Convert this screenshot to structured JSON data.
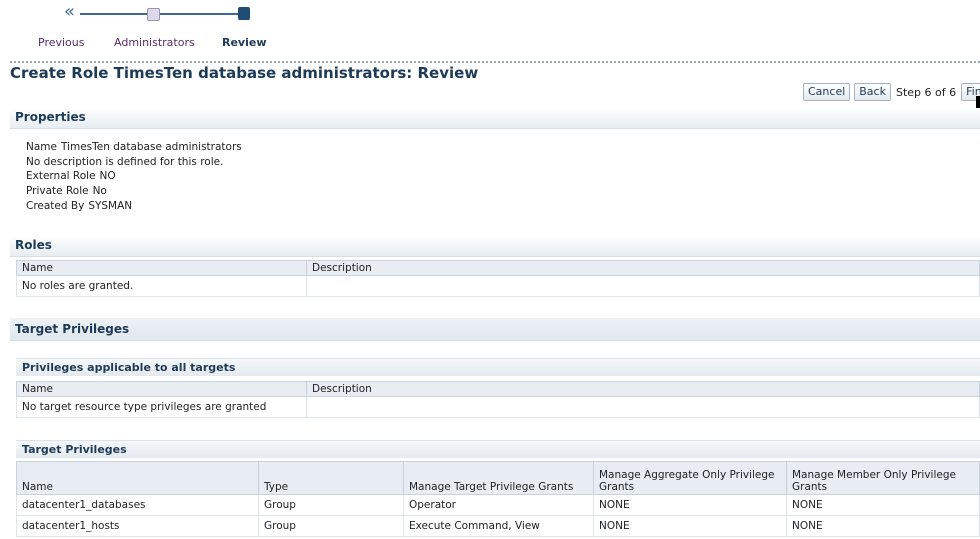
{
  "train": {
    "steps": [
      "Previous",
      "Administrators",
      "Review"
    ]
  },
  "page_title": "Create Role TimesTen database administrators: Review",
  "buttons": {
    "cancel": "Cancel",
    "back": "Back",
    "step_info": "Step 6 of 6",
    "finish": "Finis"
  },
  "properties": {
    "header": "Properties",
    "name_label": "Name",
    "name_value": "TimesTen database administrators",
    "description": "No description is defined for this role.",
    "external_label": "External Role",
    "external_value": "NO",
    "private_label": "Private Role",
    "private_value": "No",
    "created_label": "Created By",
    "created_value": "SYSMAN"
  },
  "roles": {
    "header": "Roles",
    "columns": [
      "Name",
      "Description"
    ],
    "empty": "No roles are granted."
  },
  "target_privileges": {
    "header": "Target Privileges",
    "all_targets": {
      "header": "Privileges applicable to all targets",
      "columns": [
        "Name",
        "Description"
      ],
      "empty": "No target resource type privileges are granted"
    },
    "targets": {
      "header": "Target Privileges",
      "columns": [
        "Name",
        "Type",
        "Manage Target Privilege Grants",
        "Manage Aggregate Only Privilege Grants",
        "Manage Member Only Privilege Grants"
      ],
      "rows": [
        [
          "datacenter1_databases",
          "Group",
          "Operator",
          "NONE",
          "NONE"
        ],
        [
          "datacenter1_hosts",
          "Group",
          "Execute Command, View",
          "NONE",
          "NONE"
        ]
      ]
    }
  }
}
